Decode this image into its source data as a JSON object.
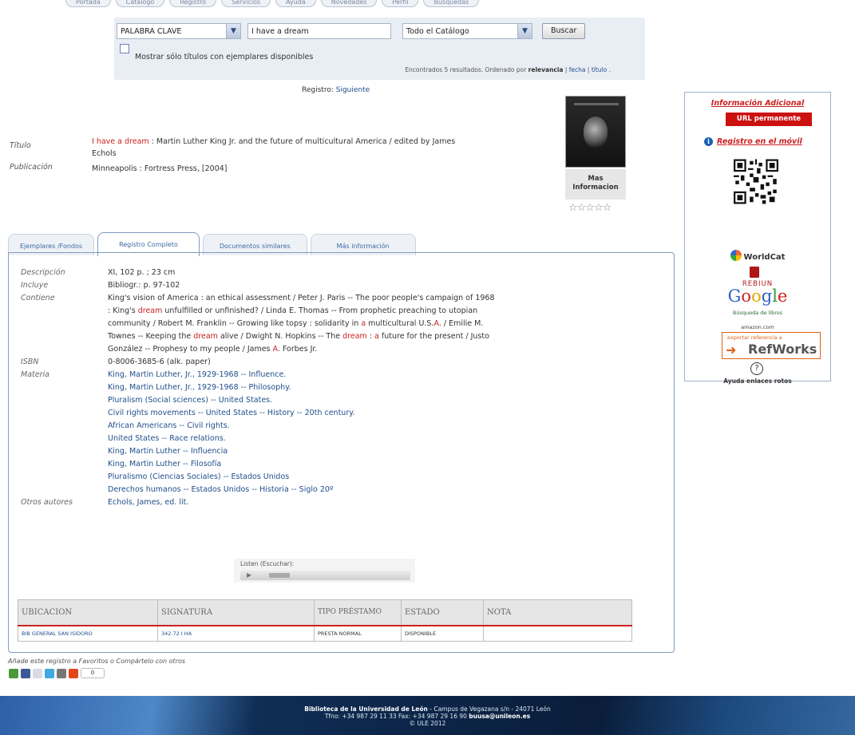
{
  "top_nav": [
    "Portada",
    "Catálogo",
    "Registro",
    "Servicios",
    "Ayuda",
    "Novedades",
    "Perfil",
    "Búsquedas"
  ],
  "search": {
    "field_select": "PALABRA CLAVE",
    "query": "I have a dream",
    "scope_select": "Todo el Catálogo",
    "button": "Buscar",
    "checkbox_label": "Mostrar sólo títulos con ejemplares disponibles",
    "results_prefix": "Encontrados 5 resultados. Ordenado por",
    "sort_relevance": "relevancia",
    "sep1": " | ",
    "sort_date": "fecha",
    "sep2": " | ",
    "sort_title": "título",
    "results_suffix": " ."
  },
  "registro": {
    "label": "Registro:",
    "next": "Siguiente"
  },
  "record": {
    "titulo_label": "Título",
    "titulo_highlight": "I have a dream",
    "titulo_rest": " : Martin Luther King Jr. and the future of multicultural America / edited by James Echols",
    "publicacion_label": "Publicación",
    "publicacion": "Minneapolis : Fortress Press, [2004]"
  },
  "cover": {
    "mas_info": "Mas Informacion",
    "stars": "☆☆☆☆☆"
  },
  "sidebar": {
    "title": "Información Adicional",
    "url_button": "URL permanente",
    "mobile": "Registro en el móvil",
    "worldcat": "WorldCat",
    "rebiun": "REBIUN",
    "google_sub": "Búsqueda de libros",
    "amazon": "amazon.com",
    "refworks_top": "exportar referencia a",
    "refworks": "RefWorks",
    "help": "Ayuda enlaces rotos"
  },
  "tabs": [
    "Ejemplares /Fondos",
    "Registro Completo",
    "Documentos similares",
    "Más información"
  ],
  "fields": {
    "descripcion_label": "Descripción",
    "descripcion": "XI, 102 p. ; 23 cm",
    "incluye_label": "Incluye",
    "incluye": "Bibliogr.: p. 97-102",
    "contiene_label": "Contiene",
    "contiene": [
      {
        "t": "King's vision of America : an ethical assessment / Peter J. Paris -- The poor people's campaign of 1968 : King's ",
        "h": false
      },
      {
        "t": "dream",
        "h": true
      },
      {
        "t": " unfulfilled or unfinished? / Linda E. Thomas -- From prophetic preaching to utopian community / Robert M. Franklin -- Growing like topsy : solidarity in ",
        "h": false
      },
      {
        "t": "a",
        "h": true
      },
      {
        "t": " multicultural U.S.",
        "h": false
      },
      {
        "t": "A.",
        "h": true
      },
      {
        "t": " / Emilie M. Townes -- Keeping the ",
        "h": false
      },
      {
        "t": "dream",
        "h": true
      },
      {
        "t": " alive / Dwight N. Hopkins -- The ",
        "h": false
      },
      {
        "t": "dream",
        "h": true
      },
      {
        "t": " : ",
        "h": false
      },
      {
        "t": "a",
        "h": true
      },
      {
        "t": " future for the present / Justo González -- Prophesy to my people / James ",
        "h": false
      },
      {
        "t": "A.",
        "h": true
      },
      {
        "t": " Forbes Jr.",
        "h": false
      }
    ],
    "isbn_label": "ISBN",
    "isbn": "0-8006-3685-6 (alk. paper)",
    "materia_label": "Materia",
    "materia": [
      "King, Martin Luther, Jr., 1929-1968 -- Influence.",
      "King, Martin Luther, Jr., 1929-1968 -- Philosophy.",
      "Pluralism (Social sciences) -- United States.",
      "Civil rights movements -- United States -- History -- 20th century.",
      "African Americans -- Civil rights.",
      "United States -- Race relations.",
      "King, Martin Luther -- Influencia",
      "King, Martin Luther -- Filosofía",
      "Pluralismo (Ciencias Sociales) -- Estados Unidos",
      "Derechos humanos -- Estados Unidos -- Historia -- Siglo 20º"
    ],
    "otros_label": "Otros autores",
    "otros": "Echols, James, ed. lit."
  },
  "player": {
    "label": "Listen (Escuchar):"
  },
  "holdings": {
    "headers": [
      "UBICACION",
      "SIGNATURA",
      "TIPO PRÉSTAMO",
      "ESTADO",
      "NOTA"
    ],
    "row": [
      "BIB GENERAL SAN ISIDORO",
      "342.72 I HA",
      "PRESTA NORMAL",
      "DISPONIBLE",
      ""
    ]
  },
  "share": {
    "label": "Añade este registro a Favoritos o Compártelo con otros",
    "count": "0"
  },
  "footer": {
    "line1_bold": "Biblioteca de la Universidad de León",
    "line1_rest": " - Campus de Vegazana s/n - 24071 León",
    "line2": "Tfno: +34 987 29 11 33 Fax: +34 987 29 16 90 ",
    "line2_bold": "buusa@unileon.es",
    "line3": "© ULE 2012"
  }
}
